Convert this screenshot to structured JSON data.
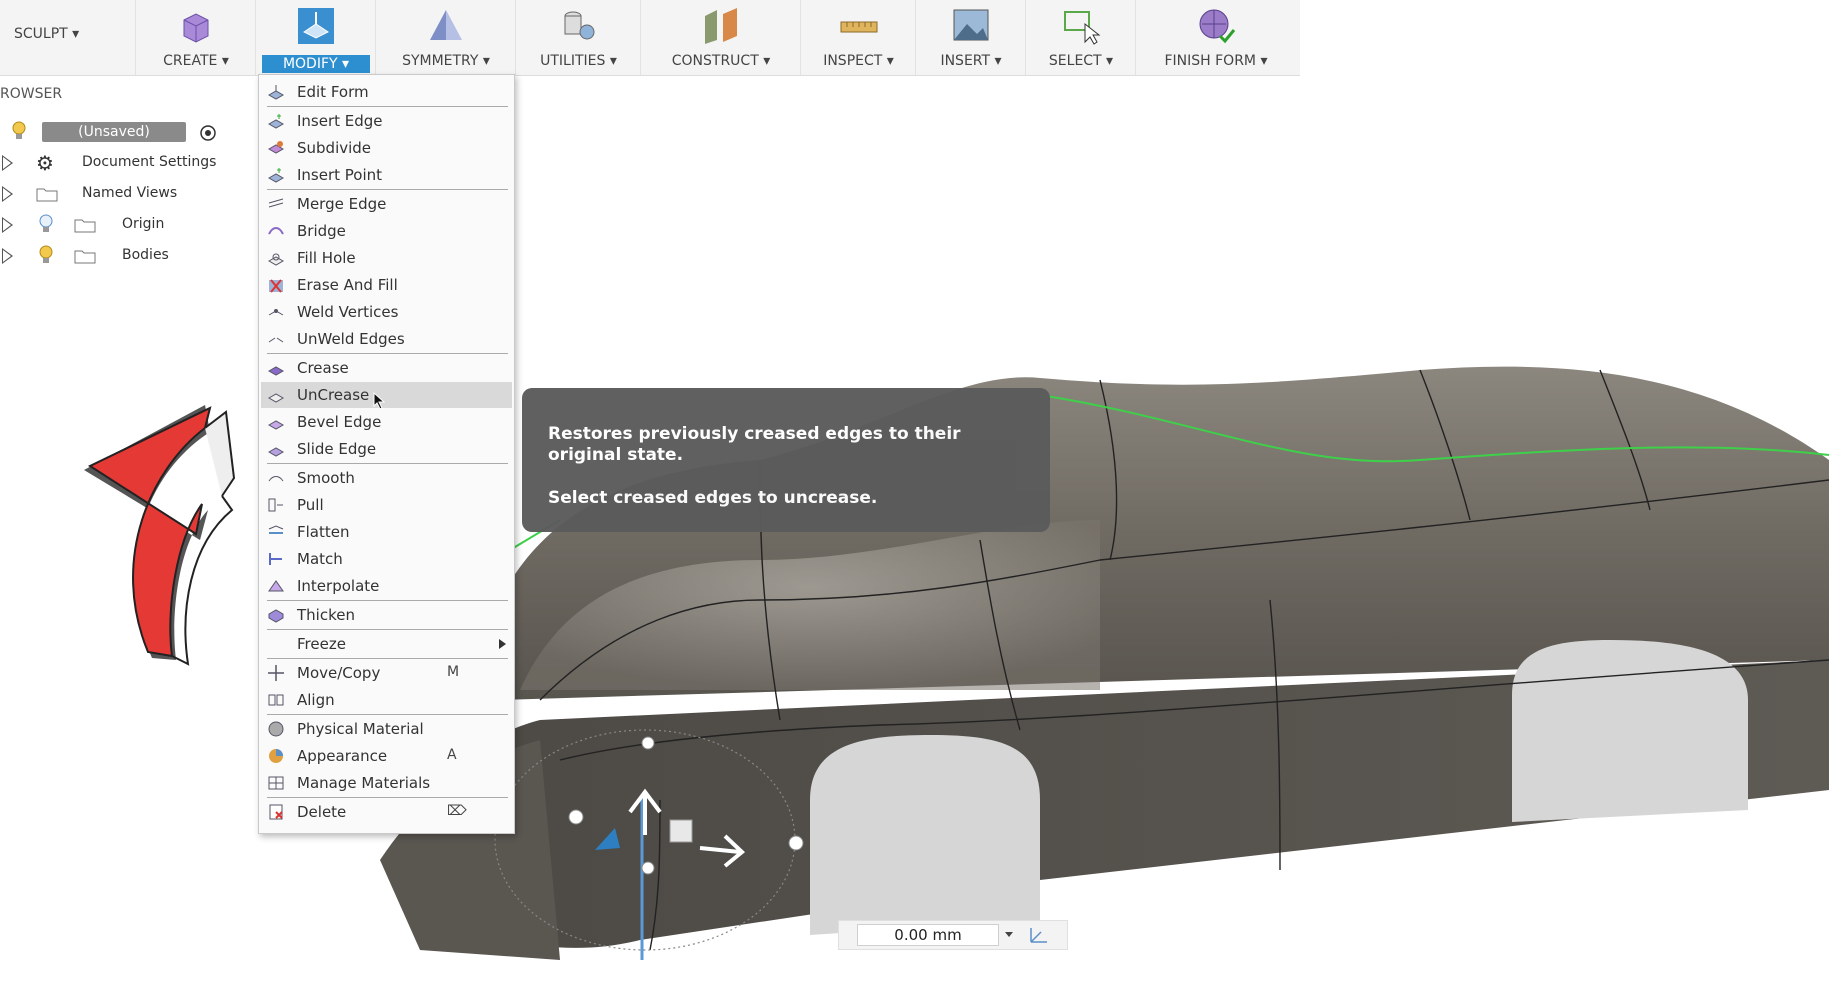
{
  "toolbar": {
    "workspace": "SCULPT ▾",
    "groups": [
      {
        "label": "CREATE ▾",
        "icon": "create-box-icon"
      },
      {
        "label": "MODIFY ▾",
        "icon": "modify-icon",
        "active": true
      },
      {
        "label": "SYMMETRY ▾",
        "icon": "symmetry-icon"
      },
      {
        "label": "UTILITIES ▾",
        "icon": "utilities-icon"
      },
      {
        "label": "CONSTRUCT ▾",
        "icon": "construct-plane-icon"
      },
      {
        "label": "INSPECT ▾",
        "icon": "inspect-ruler-icon"
      },
      {
        "label": "INSERT ▾",
        "icon": "insert-image-icon"
      },
      {
        "label": "SELECT ▾",
        "icon": "select-cursor-icon"
      },
      {
        "label": "FINISH FORM ▾",
        "icon": "finish-form-icon"
      }
    ],
    "active_color": "#2d8fd0"
  },
  "browser": {
    "title": "ROWSER",
    "root": "(Unsaved)",
    "items": [
      {
        "label": "Document Settings",
        "icon": "gear-icon"
      },
      {
        "label": "Named Views",
        "icon": "folder-icon"
      },
      {
        "label": "Origin",
        "icon": "folder-icon"
      },
      {
        "label": "Bodies",
        "icon": "folder-icon"
      }
    ]
  },
  "menu": {
    "items": [
      {
        "label": "Edit Form"
      },
      {
        "label": "Insert Edge"
      },
      {
        "label": "Subdivide"
      },
      {
        "label": "Insert Point"
      },
      {
        "label": "Merge Edge"
      },
      {
        "label": "Bridge"
      },
      {
        "label": "Fill Hole"
      },
      {
        "label": "Erase And Fill"
      },
      {
        "label": "Weld Vertices"
      },
      {
        "label": "UnWeld Edges"
      },
      {
        "label": "Crease"
      },
      {
        "label": "UnCrease",
        "highlighted": true
      },
      {
        "label": "Bevel Edge"
      },
      {
        "label": "Slide Edge"
      },
      {
        "label": "Smooth"
      },
      {
        "label": "Pull"
      },
      {
        "label": "Flatten"
      },
      {
        "label": "Match"
      },
      {
        "label": "Interpolate"
      },
      {
        "label": "Thicken"
      },
      {
        "label": "Freeze",
        "submenu": true
      },
      {
        "label": "Move/Copy",
        "shortcut": "M"
      },
      {
        "label": "Align"
      },
      {
        "label": "Physical Material"
      },
      {
        "label": "Appearance",
        "shortcut": "A"
      },
      {
        "label": "Manage Materials"
      },
      {
        "label": "Delete",
        "shortcut": "⌦"
      }
    ]
  },
  "tooltip": {
    "line1": "Restores previously creased edges to their original state.",
    "line2": "Select creased edges to uncrease."
  },
  "value_input": {
    "value": "0.00 mm"
  },
  "colors": {
    "arrow": "#e53935",
    "body": "#6e6a63",
    "wheel_well": "#d6d6d6",
    "edge_line": "#3fd04a"
  }
}
